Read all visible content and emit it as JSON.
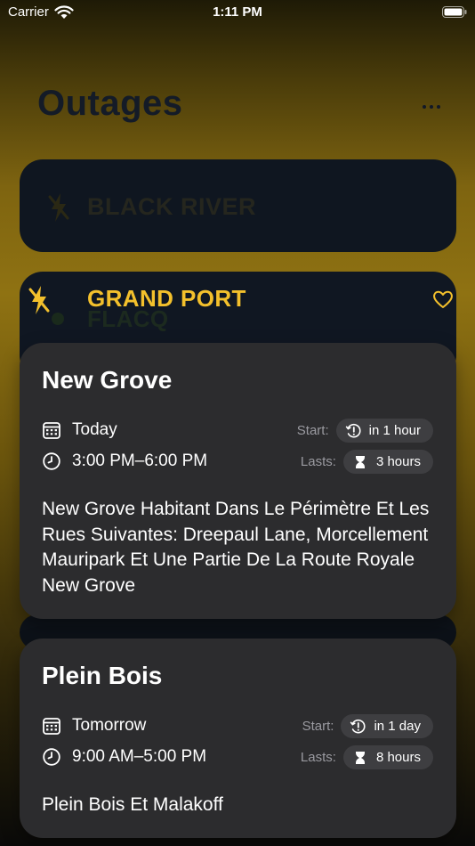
{
  "status_bar": {
    "carrier": "Carrier",
    "time": "1:11 PM"
  },
  "header": {
    "title": "Outages"
  },
  "regions": [
    {
      "name": "BLACK RIVER"
    },
    {
      "name": "GRAND PORT"
    },
    {
      "name": "FLACQ"
    }
  ],
  "outages": [
    {
      "location": "New Grove",
      "date": "Today",
      "time_range": "3:00 PM–6:00 PM",
      "start_label": "Start:",
      "start_value": "in 1 hour",
      "lasts_label": "Lasts:",
      "lasts_value": "3 hours",
      "description": "New Grove Habitant Dans Le Périmètre Et Les Rues Suivantes: Dreepaul Lane, Morcellement Mauripark Et Une Partie De La Route Royale New Grove"
    },
    {
      "location": "Plein Bois",
      "date": "Tomorrow",
      "time_range": "9:00 AM–5:00 PM",
      "start_label": "Start:",
      "start_value": "in 1 day",
      "lasts_label": "Lasts:",
      "lasts_value": "8 hours",
      "description": "Plein Bois Et Malakoff"
    }
  ],
  "colors": {
    "accent": "#f3c02c",
    "card": "#2c2c2e",
    "pill": "#3e3e41"
  },
  "icons": [
    "wifi-icon",
    "battery-icon",
    "more-icon",
    "bolt-slash-icon",
    "heart-icon",
    "calendar-icon",
    "clock-icon",
    "clock-alert-icon",
    "hourglass-icon"
  ]
}
